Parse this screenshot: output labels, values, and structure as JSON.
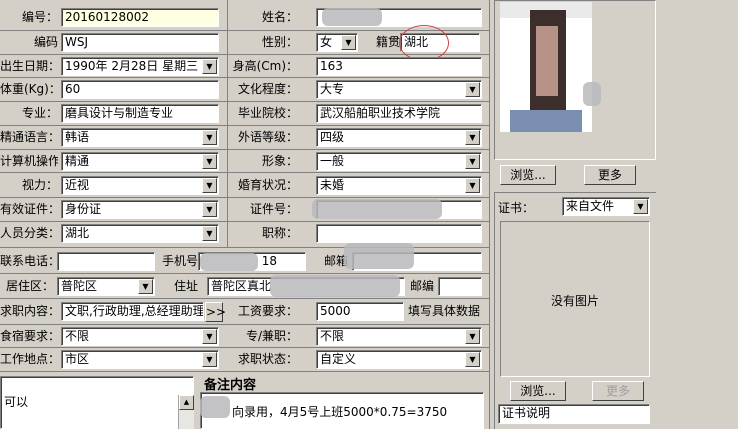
{
  "form": {
    "no_label": "编号：",
    "no_value": "20160128002",
    "code_label": "编码",
    "code_value": "WSJ",
    "birth_label": "出生日期：",
    "birth_value": "1990年 2月28日 星期三",
    "weight_label": "体重(Kg)：",
    "weight_value": "60",
    "major_label": "专业：",
    "major_value": "磨具设计与制造专业",
    "lang_label": "精通语言：",
    "lang_value": "韩语",
    "computer_label": "计算机操作：",
    "computer_value": "精通",
    "vision_label": "视力：",
    "vision_value": "近视",
    "id_type_label": "有效证件：",
    "id_type_value": "身份证",
    "category_label": "人员分类：",
    "category_value": "湖北",
    "name_label": "姓名：",
    "gender_label": "性别：",
    "gender_value": "女",
    "native_label": "籍贯",
    "native_value": "湖北",
    "height_label": "身高(Cm)：",
    "height_value": "163",
    "edu_label": "文化程度：",
    "edu_value": "大专",
    "school_label": "毕业院校：",
    "school_value": "武汉船舶职业技术学院",
    "foreign_label": "外语等级：",
    "foreign_value": "四级",
    "appearance_label": "形象：",
    "appearance_value": "一般",
    "marital_label": "婚育状况：",
    "marital_value": "未婚",
    "idno_label": "证件号：",
    "title_label": "职称：",
    "phone_label": "联系电话：",
    "mobile_label": "手机号",
    "mobile_value_suffix": "18",
    "email_label": "邮箱",
    "area_label": "居住区：",
    "area_value": "普陀区",
    "address_label": "住址",
    "address_value": "普陀区真北",
    "postcode_label": "邮编",
    "job_label": "求职内容：",
    "job_value": "文职,行政助理,总经理助理",
    "more_btn": ">>",
    "salary_label": "工资要求：",
    "salary_value": "5000",
    "salary_hint": "填写具体数据",
    "lodging_label": "食宿要求：",
    "lodging_value": "不限",
    "fulltime_label": "专/兼职：",
    "fulltime_value": "不限",
    "workplace_label": "工作地点：",
    "workplace_value": "市区",
    "status_label": "求职状态：",
    "status_value": "自定义",
    "left_note": "可以",
    "remark_title": "备注内容",
    "remark_value": "向录用，4月5号上班5000*0.75=3750"
  },
  "photo": {
    "browse_btn": "浏览...",
    "more_btn": "更多"
  },
  "cert": {
    "label": "证书：",
    "source_value": "来自文件",
    "empty_text": "没有图片",
    "browse_btn": "浏览...",
    "more_btn": "更多",
    "desc_value": "证书说明"
  },
  "colors": {
    "window_bg": "#d4d0c8",
    "input_bg": "#ffffff",
    "highlight_input_bg": "#ffffe1",
    "annotation_circle": "#d04040"
  }
}
